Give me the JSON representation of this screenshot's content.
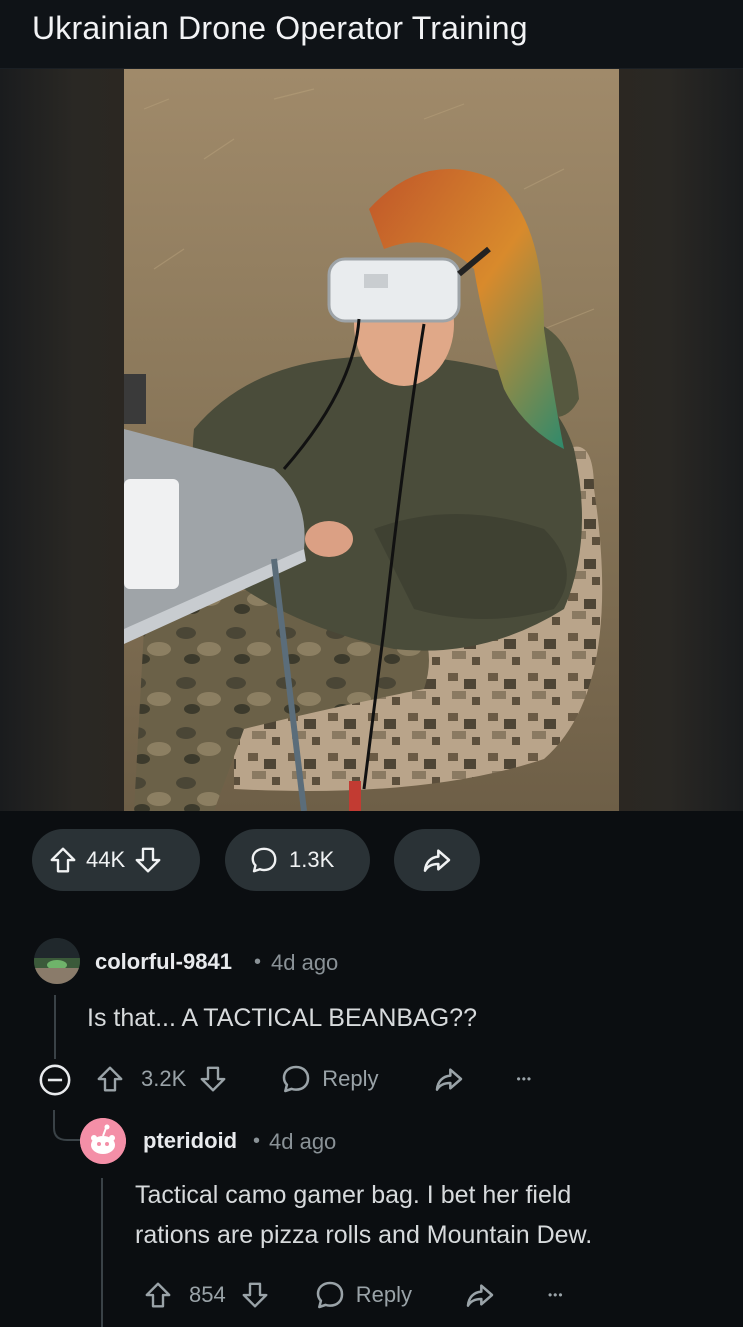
{
  "post": {
    "title": "Ukrainian Drone Operator Training",
    "image_alt": "Woman with braided multicolored hair wearing white FPV goggles, seated on a camouflage beanbag in a dry field beside a folding table",
    "upvotes": "44K",
    "comments": "1.3K"
  },
  "comments": [
    {
      "author": "colorful-9841",
      "age": "4d ago",
      "body": "Is that... A TACTICAL BEANBAG??",
      "votes": "3.2K",
      "reply_label": "Reply"
    },
    {
      "author": "pteridoid",
      "age": "4d ago",
      "body_line1": "Tactical camo gamer bag. I bet her field",
      "body_line2": "rations are pizza rolls and Mountain Dew.",
      "votes": "854",
      "reply_label": "Reply"
    }
  ],
  "separator": "•",
  "more": "•••",
  "colors": {
    "background": "#0b0e11",
    "pill": "#2a3236",
    "avatar_pink": "#f48fa7"
  }
}
